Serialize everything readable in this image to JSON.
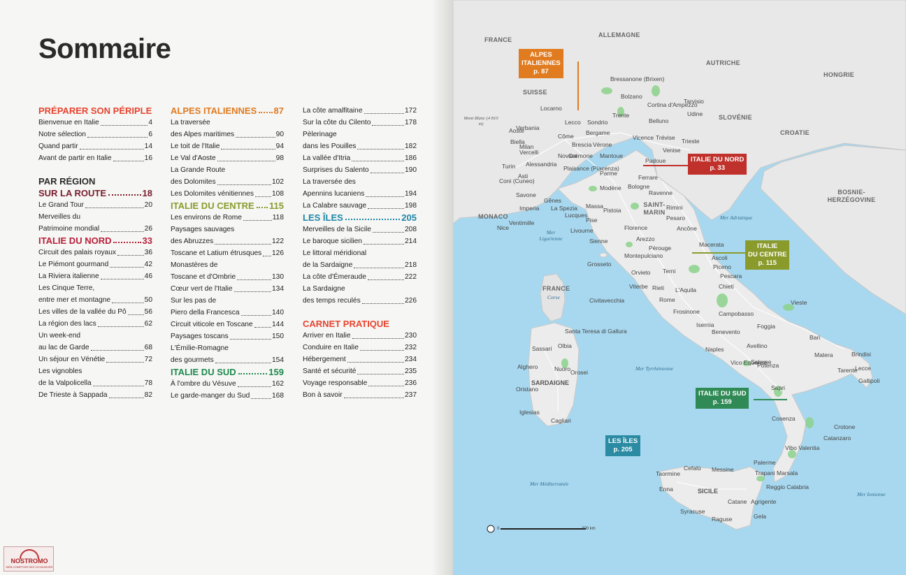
{
  "title": "Sommaire",
  "toc": {
    "col1": [
      {
        "type": "section",
        "text": "PRÉPARER SON PÉRIPLE",
        "color": "red"
      },
      {
        "type": "entry",
        "text": "Bienvenue en Italie",
        "page": "4"
      },
      {
        "type": "entry",
        "text": "Notre sélection",
        "page": "6"
      },
      {
        "type": "entry",
        "text": "Quand partir",
        "page": "14"
      },
      {
        "type": "entry",
        "text": "Avant de partir en Italie",
        "page": "16"
      },
      {
        "type": "section",
        "text": "PAR RÉGION",
        "color": "dark",
        "space": true
      },
      {
        "type": "section",
        "text": "SUR LA ROUTE",
        "page": "18",
        "color": "maroon"
      },
      {
        "type": "entry",
        "text": "Le Grand Tour",
        "page": "20"
      },
      {
        "type": "cont",
        "text": "Merveilles du"
      },
      {
        "type": "entry",
        "text": "Patrimoine mondial",
        "page": "26"
      },
      {
        "type": "section",
        "text": "ITALIE DU NORD",
        "page": "33",
        "color": "crimson"
      },
      {
        "type": "entry",
        "text": "Circuit des palais royaux",
        "page": "36"
      },
      {
        "type": "entry",
        "text": "Le Piémont gourmand",
        "page": "42"
      },
      {
        "type": "entry",
        "text": "La Riviera italienne",
        "page": "46"
      },
      {
        "type": "cont",
        "text": "Les Cinque Terre,"
      },
      {
        "type": "entry",
        "text": "entre mer et montagne",
        "page": "50"
      },
      {
        "type": "entry",
        "text": "Les villes de la vallée du Pô",
        "page": "56"
      },
      {
        "type": "entry",
        "text": "La région des lacs",
        "page": "62"
      },
      {
        "type": "cont",
        "text": "Un week-end"
      },
      {
        "type": "entry",
        "text": "au lac de Garde",
        "page": "68"
      },
      {
        "type": "entry",
        "text": "Un séjour en Vénétie",
        "page": "72"
      },
      {
        "type": "cont",
        "text": "Les vignobles"
      },
      {
        "type": "entry",
        "text": "de la Valpolicella",
        "page": "78"
      },
      {
        "type": "entry",
        "text": "De Trieste à Sappada",
        "page": "82"
      }
    ],
    "col2": [
      {
        "type": "section",
        "text": "ALPES ITALIENNES",
        "page": "87",
        "color": "orange"
      },
      {
        "type": "cont",
        "text": "La traversée"
      },
      {
        "type": "entry",
        "text": "des Alpes maritimes",
        "page": "90"
      },
      {
        "type": "entry",
        "text": "Le toit de l'Italie",
        "page": "94"
      },
      {
        "type": "entry",
        "text": "Le Val d'Aoste",
        "page": "98"
      },
      {
        "type": "cont",
        "text": "La Grande Route"
      },
      {
        "type": "entry",
        "text": "des Dolomites",
        "page": "102"
      },
      {
        "type": "entry",
        "text": "Les Dolomites vénitiennes",
        "page": "108"
      },
      {
        "type": "section",
        "text": "ITALIE DU CENTRE",
        "page": "115",
        "color": "olive"
      },
      {
        "type": "entry",
        "text": "Les environs de Rome",
        "page": "118"
      },
      {
        "type": "cont",
        "text": "Paysages sauvages"
      },
      {
        "type": "entry",
        "text": "des Abruzzes",
        "page": "122"
      },
      {
        "type": "entry",
        "text": "Toscane et Latium étrusques",
        "page": "126"
      },
      {
        "type": "cont",
        "text": "Monastères de"
      },
      {
        "type": "entry",
        "text": "Toscane et d'Ombrie",
        "page": "130"
      },
      {
        "type": "entry",
        "text": "Cœur vert de l'Italie",
        "page": "134"
      },
      {
        "type": "cont",
        "text": "Sur les pas de"
      },
      {
        "type": "entry",
        "text": "Piero della Francesca",
        "page": "140"
      },
      {
        "type": "entry",
        "text": "Circuit viticole en Toscane",
        "page": "144"
      },
      {
        "type": "entry",
        "text": "Paysages toscans",
        "page": "150"
      },
      {
        "type": "cont",
        "text": "L'Émilie-Romagne"
      },
      {
        "type": "entry",
        "text": "des gourmets",
        "page": "154"
      },
      {
        "type": "section",
        "text": "ITALIE DU SUD",
        "page": "159",
        "color": "green"
      },
      {
        "type": "entry",
        "text": "À l'ombre du Vésuve",
        "page": "162"
      },
      {
        "type": "entry",
        "text": "Le garde-manger du Sud",
        "page": "168"
      }
    ],
    "col3": [
      {
        "type": "entry",
        "text": "La côte amalfitaine",
        "page": "172"
      },
      {
        "type": "entry",
        "text": "Sur la côte du Cilento",
        "page": "178"
      },
      {
        "type": "cont",
        "text": "Pèlerinage"
      },
      {
        "type": "entry",
        "text": "dans les Pouilles",
        "page": "182"
      },
      {
        "type": "entry",
        "text": "La vallée d'Itria",
        "page": "186"
      },
      {
        "type": "entry",
        "text": "Surprises du Salento",
        "page": "190"
      },
      {
        "type": "cont",
        "text": "La traversée des"
      },
      {
        "type": "entry",
        "text": "Apennins lucaniens",
        "page": "194"
      },
      {
        "type": "entry",
        "text": "La Calabre sauvage",
        "page": "198"
      },
      {
        "type": "section",
        "text": "LES ÎLES",
        "page": "205",
        "color": "teal"
      },
      {
        "type": "entry",
        "text": "Merveilles de la Sicile",
        "page": "208"
      },
      {
        "type": "entry",
        "text": "Le baroque sicilien",
        "page": "214"
      },
      {
        "type": "cont",
        "text": "Le littoral méridional"
      },
      {
        "type": "entry",
        "text": "de la Sardaigne",
        "page": "218"
      },
      {
        "type": "entry",
        "text": "La côte d'Émeraude",
        "page": "222"
      },
      {
        "type": "cont",
        "text": "La Sardaigne"
      },
      {
        "type": "entry",
        "text": "des temps reculés",
        "page": "226"
      },
      {
        "type": "section",
        "text": "CARNET PRATIQUE",
        "color": "red",
        "space": true
      },
      {
        "type": "entry",
        "text": "Arriver en Italie",
        "page": "230"
      },
      {
        "type": "entry",
        "text": "Conduire en Italie",
        "page": "232"
      },
      {
        "type": "entry",
        "text": "Hébergement",
        "page": "234"
      },
      {
        "type": "entry",
        "text": "Santé et sécurité",
        "page": "235"
      },
      {
        "type": "entry",
        "text": "Voyage responsable",
        "page": "236"
      },
      {
        "type": "entry",
        "text": "Bon à savoir",
        "page": "237"
      }
    ]
  },
  "logo": {
    "name": "NOSTROMO",
    "tagline": "WEB COMPTOIR DES VOYAGEURS"
  },
  "map": {
    "countries": [
      "FRANCE",
      "ALLEMAGNE",
      "SUISSE",
      "AUTRICHE",
      "HONGRIE",
      "SLOVÉNIE",
      "CROATIE",
      "BOSNIE-HERZÉGOVINE",
      "MONACO",
      "SAINT-MARIN",
      "FRANCE"
    ],
    "corse": "Corse",
    "seas": {
      "ligurienne": "Mer Ligurienne",
      "adriatique": "Mer Adriatique",
      "tyrrhenienne": "Mer Tyrrhénienne",
      "mediterranee": "Mer Méditerranée",
      "ionienne": "Mer Ionienne"
    },
    "mont_blanc": "Mont Blanc (4 810 m)",
    "islands": {
      "sardaigne": "SARDAIGNE",
      "sicile": "SICILE"
    },
    "cities": [
      "Bressanone (Brixen)",
      "Bolzano",
      "Cortina d'Ampezzo",
      "Tarvisio",
      "Locarno",
      "Trente",
      "Udine",
      "Lecco",
      "Sondrio",
      "Bergame",
      "Belluno",
      "Aoste",
      "Verbania",
      "Côme",
      "Brescia",
      "Vérone",
      "Vicence",
      "Trévise",
      "Trieste",
      "Biella",
      "Milan",
      "Venise",
      "Vercelli",
      "Novara",
      "Crémone",
      "Mantoue",
      "Padoue",
      "Turin",
      "Alessandria",
      "Plaisance (Piacenza)",
      "Parme",
      "Ferrare",
      "Asti",
      "Coni (Cuneo)",
      "Modène",
      "Bologne",
      "Ravenne",
      "Savone",
      "Gênes",
      "Imperia",
      "La Spezia",
      "Massa",
      "Pistoia",
      "Rimini",
      "Lucques",
      "Pise",
      "Pesaro",
      "Ventimille",
      "Nice",
      "Livourne",
      "Florence",
      "Ancône",
      "Sienne",
      "Arezzo",
      "Pérouge",
      "Macerata",
      "Montepulciano",
      "Ascoli",
      "Piceno",
      "Grosseto",
      "Orvieto",
      "Terni",
      "Pescara",
      "Viterbe",
      "Rieti",
      "L'Aquila",
      "Chieti",
      "Civitavecchia",
      "Rome",
      "Vieste",
      "Frosinone",
      "Campobasso",
      "Isernia",
      "Foggia",
      "Santa Teresa di Gallura",
      "Olbia",
      "Benevento",
      "Bari",
      "Sassari",
      "Naples",
      "Avellino",
      "Matera",
      "Brindisi",
      "Vico Equense",
      "Salerne",
      "Potenza",
      "Lecce",
      "Alghero",
      "Nuoro",
      "Orosei",
      "Tarente",
      "Gallipoli",
      "Oristano",
      "Sapri",
      "Iglesias",
      "Cagliari",
      "Cosenza",
      "Crotone",
      "Catanzaro",
      "Vibo Valentia",
      "Palerme",
      "Cefalù",
      "Messine",
      "Trapani",
      "Taormine",
      "Reggio Calabria",
      "Marsala",
      "Enna",
      "Catane",
      "Agrigente",
      "Syracuse",
      "Gela",
      "Raguse"
    ],
    "callouts": [
      {
        "text1": "ALPES",
        "text2": "ITALIENNES",
        "page": "p. 87",
        "color": "#e07b20"
      },
      {
        "text1": "ITALIE DU NORD",
        "text2": "",
        "page": "p. 33",
        "color": "#c0312b"
      },
      {
        "text1": "ITALIE",
        "text2": "DU CENTRE",
        "page": "p. 115",
        "color": "#8a9b2c"
      },
      {
        "text1": "ITALIE DU SUD",
        "text2": "",
        "page": "p. 159",
        "color": "#2f8a55"
      },
      {
        "text1": "LES ÎLES",
        "text2": "",
        "page": "p. 205",
        "color": "#2a8ba3"
      }
    ],
    "scale": {
      "start": "0",
      "end": "200 km"
    }
  },
  "colors": {
    "red": "#e8432e",
    "maroon": "#7a1d2c",
    "crimson": "#b8203a",
    "orange": "#e07b20",
    "olive": "#8a9b2c",
    "green": "#1e8a4e",
    "teal": "#1d87a8",
    "sea": "#a8d8ef",
    "land": "#e8e8e8"
  }
}
